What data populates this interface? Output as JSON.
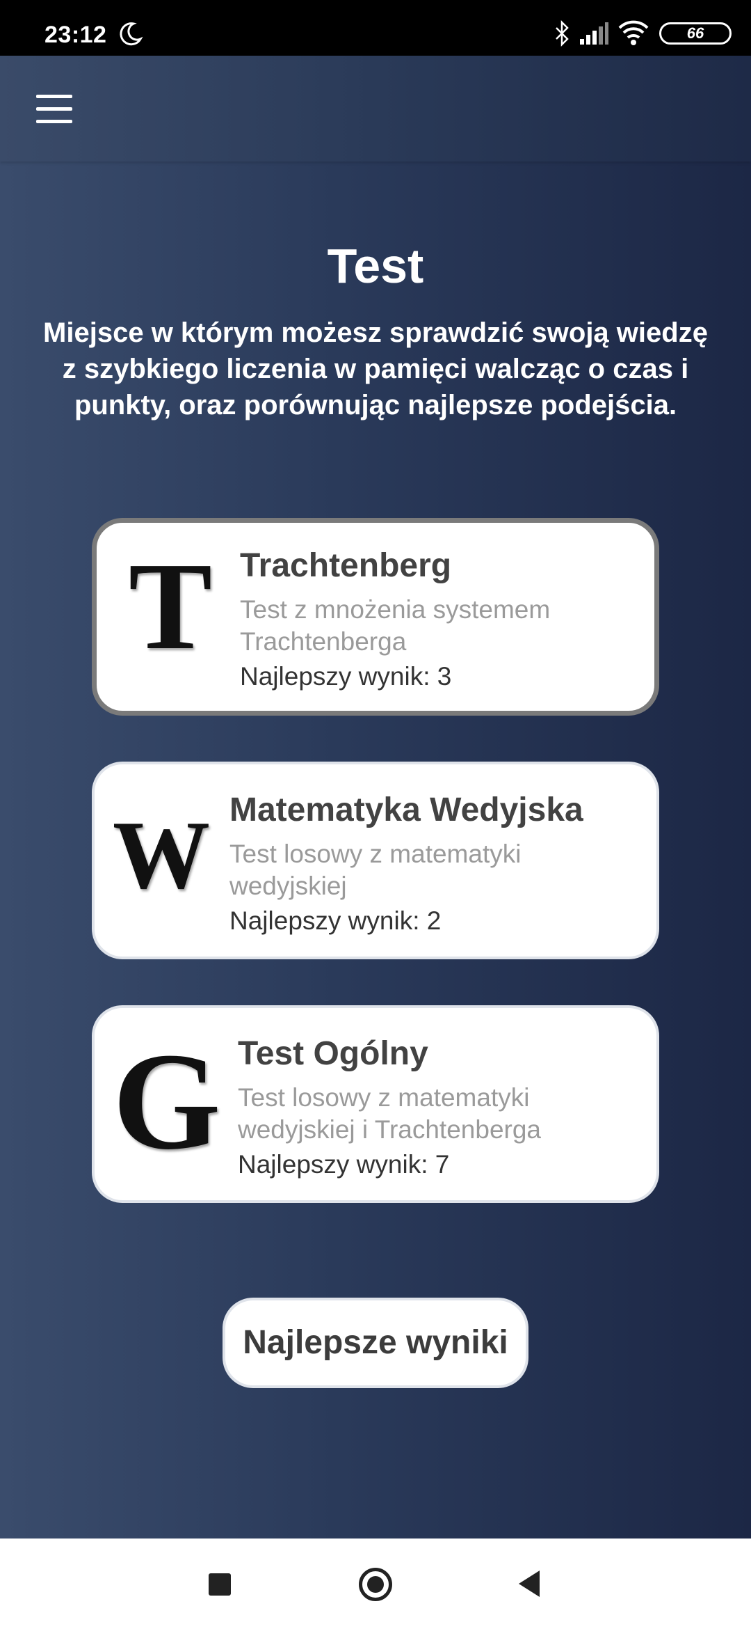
{
  "status_bar": {
    "time": "23:12",
    "battery": "66",
    "icons": [
      "moon-icon",
      "bluetooth-icon",
      "signal-icon",
      "wifi-icon",
      "battery-icon"
    ]
  },
  "app_bar": {
    "menu_icon": "hamburger-menu-icon"
  },
  "header": {
    "title": "Test",
    "description": "Miejsce w którym możesz sprawdzić swoją wiedzę z szybkiego liczenia w pamięci walcząc o czas i punkty, oraz porównując najlepsze podejścia."
  },
  "tests": [
    {
      "letter": "T",
      "title": "Trachtenberg",
      "subtitle": "Test z mnożenia systemem Trachtenberga",
      "best_score": "Najlepszy wynik: 3",
      "selected": true
    },
    {
      "letter": "W",
      "title": "Matematyka Wedyjska",
      "subtitle": "Test losowy z matematyki wedyjskiej",
      "best_score": "Najlepszy wynik: 2",
      "selected": false
    },
    {
      "letter": "G",
      "title": "Test Ogólny",
      "subtitle": "Test losowy z matematyki wedyjskiej i Trachtenberga",
      "best_score": "Najlepszy wynik: 7",
      "selected": false
    }
  ],
  "results_button": "Najlepsze wyniki",
  "nav_bar": {
    "icons": [
      "recents-square-icon",
      "home-circle-icon",
      "back-triangle-icon"
    ]
  },
  "colors": {
    "background_left": "#3a4c6c",
    "background_right": "#1c2745",
    "card_background": "#ffffff",
    "selected_border": "#7a7a7a",
    "subtitle_text": "#9a9a9a"
  }
}
